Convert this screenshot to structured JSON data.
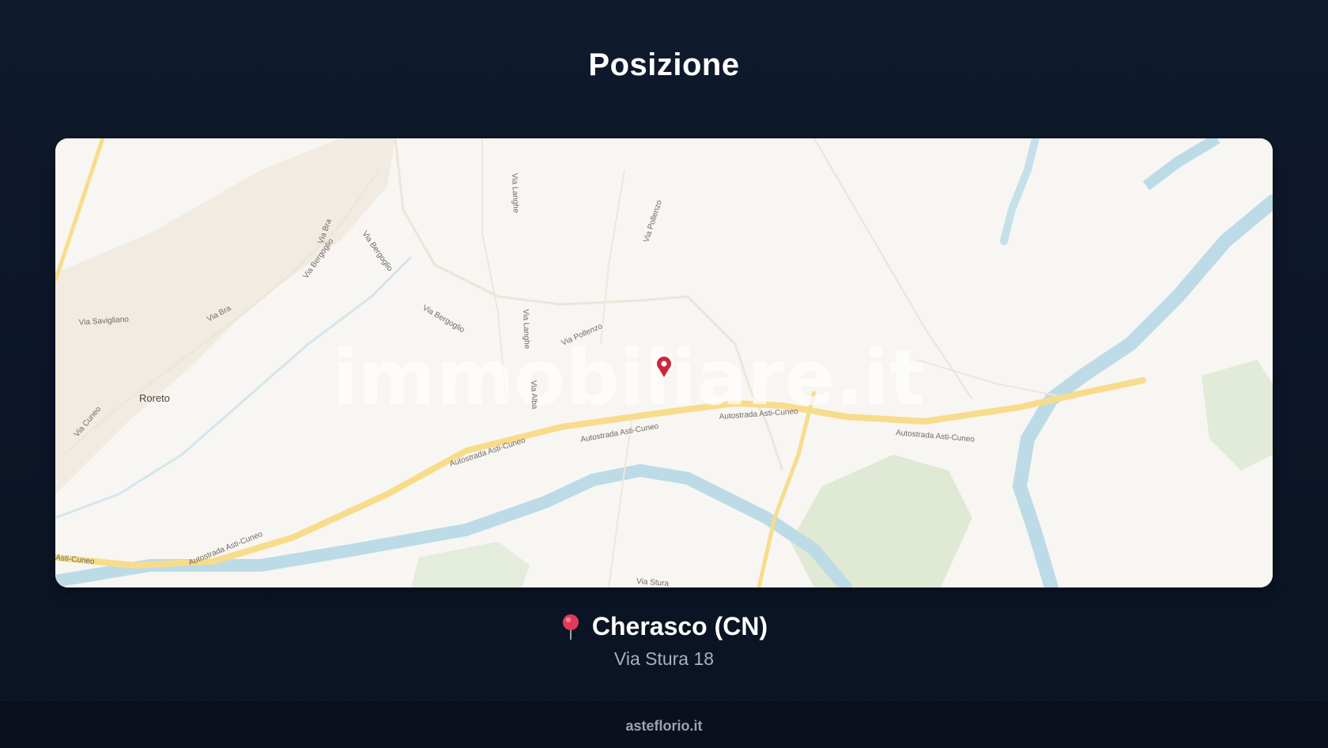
{
  "page": {
    "title": "Posizione"
  },
  "map": {
    "watermark": "immobiliare.it",
    "town_label": "Roreto",
    "street_labels": {
      "via_savigliano": "Via Savigliano",
      "via_bra_1": "Via Bra",
      "via_bra_2": "Via Bra",
      "via_bergoglio_1": "Via Bergoglio",
      "via_bergoglio_2": "Via Bergoglio",
      "via_bergoglio_3": "Via Bergoglio",
      "via_langhe_1": "Via Langhe",
      "via_langhe_2": "Via Langhe",
      "via_pollenzo_1": "Via Pollenzo",
      "via_pollenzo_2": "Via Pollenzo",
      "via_alba": "Via Alba",
      "via_cuneo": "Via Cuneo",
      "via_stura": "Via Stura",
      "autostrada_1": "Autostrada Asti-Cuneo",
      "autostrada_2": "Autostrada Asti-Cuneo",
      "autostrada_3": "Autostrada Asti-Cuneo",
      "autostrada_4": "Autostrada Asti-Cuneo",
      "autostrada_5": "Autostrada Asti-Cuneo",
      "autostrada_6": "Asti-Cuneo"
    },
    "marker_icon": "map-pin-marker-icon"
  },
  "location": {
    "icon": "pushpin-icon",
    "city": "Cherasco (CN)",
    "address": "Via Stura 18"
  },
  "footer": {
    "site": "asteflorio.it"
  },
  "colors": {
    "background": "#0c1628",
    "map_land": "#f8f6f2",
    "water": "#b9d9e6",
    "motorway": "#f7dc8c",
    "marker": "#c9283b"
  }
}
